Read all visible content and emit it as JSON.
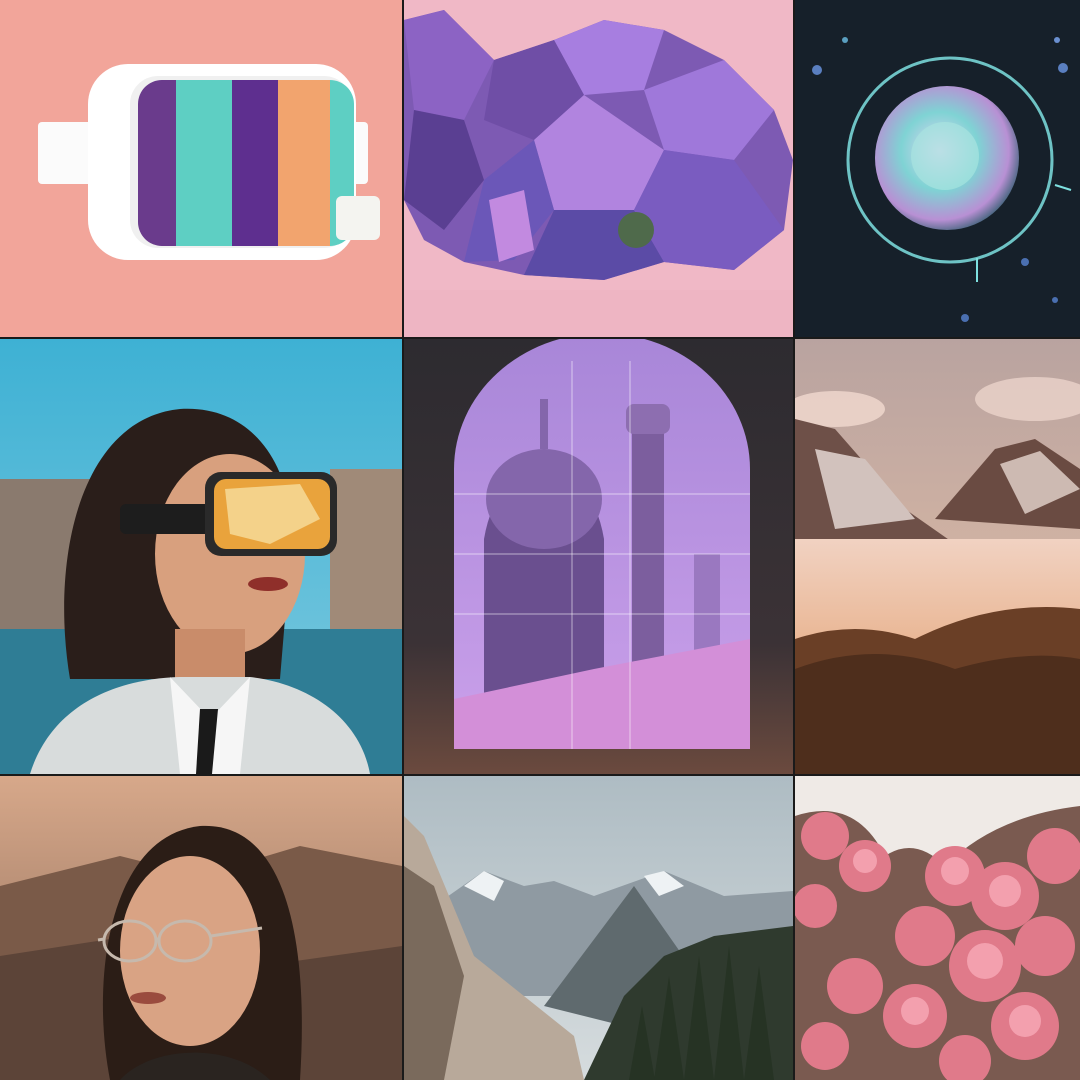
{
  "collage": {
    "tiles": [
      {
        "subject": "vr-headset-illustration",
        "background": "#f2a59a"
      },
      {
        "subject": "purple-crystal-rocks",
        "background": "#f0b8c6"
      },
      {
        "subject": "glowing-orb-in-space",
        "background": "#16202a"
      },
      {
        "subject": "woman-with-vr-goggles",
        "background": "#40b4d6"
      },
      {
        "subject": "arched-window-temple",
        "background": "#2b2a30"
      },
      {
        "subject": "mountains-above-clouds",
        "background": "#c9a08e"
      },
      {
        "subject": "woman-with-glasses-portrait",
        "background": "#b88a70"
      },
      {
        "subject": "alpine-valley-forest",
        "background": "#b9c6cc"
      },
      {
        "subject": "pink-flower-bush",
        "background": "#efeae6"
      }
    ]
  }
}
